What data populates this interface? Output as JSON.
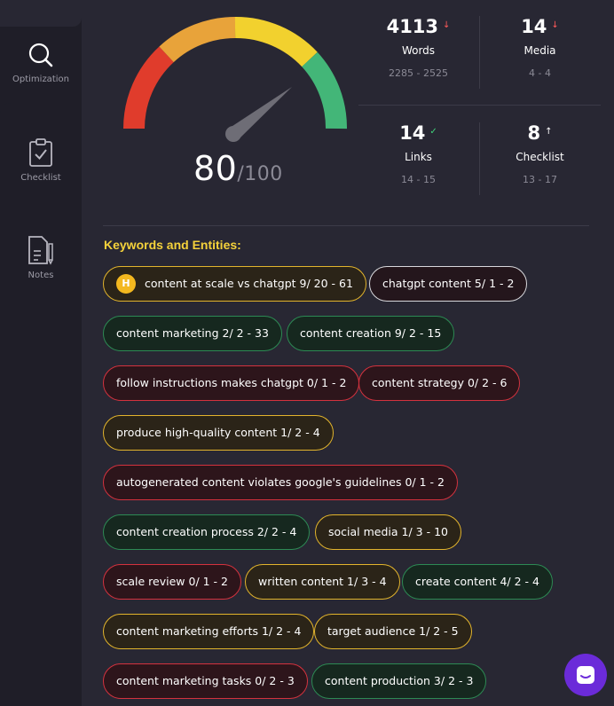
{
  "sidebar": {
    "items": [
      {
        "label": "Optimization",
        "icon": "search-icon",
        "active": true
      },
      {
        "label": "Checklist",
        "icon": "clipboard-check-icon",
        "active": false
      },
      {
        "label": "Notes",
        "icon": "notes-icon",
        "active": false
      }
    ]
  },
  "score": {
    "value": "80",
    "max": "/100"
  },
  "stats": [
    {
      "value": "4113",
      "arrow": "↓",
      "arrow_color": "#ff5a5a",
      "label": "Words",
      "range": "2285 - 2525"
    },
    {
      "value": "14",
      "arrow": "↓",
      "arrow_color": "#ff5a5a",
      "label": "Media",
      "range": "4 - 4"
    },
    {
      "value": "14",
      "arrow": "✓",
      "arrow_color": "#3fd47a",
      "label": "Links",
      "range": "14 - 15"
    },
    {
      "value": "8",
      "arrow": "↑",
      "arrow_color": "#ffffff",
      "label": "Checklist",
      "range": "13 - 17"
    }
  ],
  "keywords": {
    "title": "Keywords and Entities:",
    "badge_letter": "H",
    "chips": [
      {
        "text": "content at scale vs chatgpt 9/ 20 - 61",
        "status": "yellow"
      },
      {
        "text": "chatgpt content 5/ 1 - 2",
        "status": "white"
      },
      {
        "text": "content marketing 2/ 2 - 33",
        "status": "green"
      },
      {
        "text": "content creation 9/ 2 - 15",
        "status": "green"
      },
      {
        "text": "follow instructions makes chatgpt 0/ 1 - 2",
        "status": "red"
      },
      {
        "text": "content strategy 0/ 2 - 6",
        "status": "red"
      },
      {
        "text": "produce high-quality content 1/ 2 - 4",
        "status": "yellow"
      },
      {
        "text": "autogenerated content violates google's guidelines 0/ 1 - 2",
        "status": "red"
      },
      {
        "text": "content creation process 2/ 2 - 4",
        "status": "green"
      },
      {
        "text": "social media 1/ 3 - 10",
        "status": "yellow"
      },
      {
        "text": "scale review 0/ 1 - 2",
        "status": "red"
      },
      {
        "text": "written content 1/ 3 - 4",
        "status": "yellow"
      },
      {
        "text": "create content 4/ 2 - 4",
        "status": "green"
      },
      {
        "text": "content marketing efforts 1/ 2 - 4",
        "status": "yellow"
      },
      {
        "text": "target audience 1/ 2 - 5",
        "status": "yellow"
      },
      {
        "text": "content marketing tasks 0/ 2 - 3",
        "status": "red"
      },
      {
        "text": "content production 3/ 2 - 3",
        "status": "green"
      }
    ]
  },
  "colors": {
    "accent_yellow": "#f5d23b",
    "gauge_red": "#e03c2c",
    "gauge_orange": "#e8a33a",
    "gauge_yellow": "#f2d12e",
    "gauge_green": "#43b678",
    "chat_purple": "#6b2bd9"
  },
  "chat": {
    "icon": "chat-icon"
  }
}
